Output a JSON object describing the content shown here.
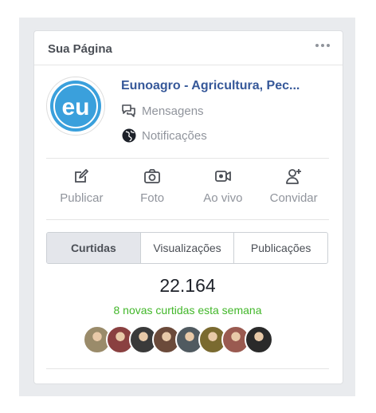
{
  "card": {
    "title": "Sua Página",
    "more_icon": "more-horizontal-icon"
  },
  "page": {
    "name": "Eunoagro - Agricultura, Pec...",
    "logo_text": "eu",
    "logo_color": "#3aa0dc",
    "messages_label": "Mensagens",
    "notifications_label": "Notificações"
  },
  "actions": [
    {
      "label": "Publicar",
      "icon": "compose-icon"
    },
    {
      "label": "Foto",
      "icon": "camera-icon"
    },
    {
      "label": "Ao vivo",
      "icon": "live-video-icon"
    },
    {
      "label": "Convidar",
      "icon": "add-person-icon"
    }
  ],
  "tabs": [
    {
      "label": "Curtidas",
      "selected": true
    },
    {
      "label": "Visualizações",
      "selected": false
    },
    {
      "label": "Publicações",
      "selected": false
    }
  ],
  "stats": {
    "likes_count": "22.164",
    "likes_subtitle": "8 novas curtidas esta semana"
  },
  "avatar_colors": [
    "#9a8b6a",
    "#8a4040",
    "#3a3a3a",
    "#6b4a3a",
    "#505a60",
    "#7a6a30",
    "#9a5a50",
    "#2a2a2a"
  ],
  "colors": {
    "link": "#365899",
    "green": "#42b72a",
    "muted": "#90949c"
  }
}
